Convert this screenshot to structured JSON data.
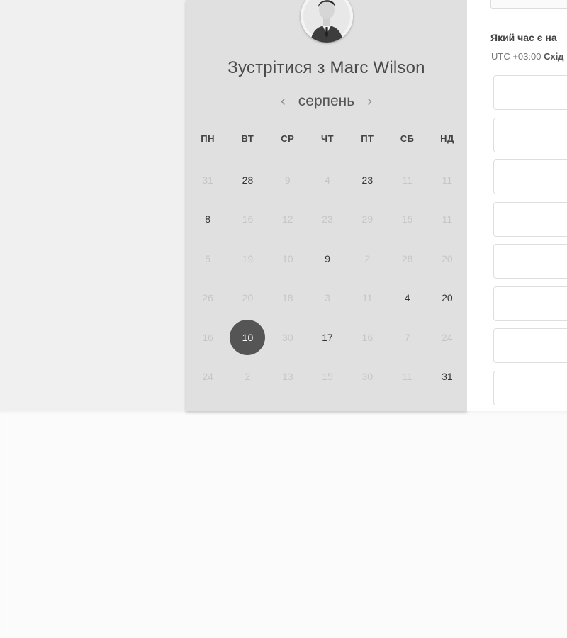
{
  "scheduler": {
    "title": "Зустрітися з Marc Wilson",
    "month": "серпень",
    "prev_icon": "‹",
    "next_icon": "›",
    "weekdays": [
      "ПН",
      "ВТ",
      "СР",
      "ЧТ",
      "ПТ",
      "СБ",
      "НД"
    ],
    "weeks": [
      [
        {
          "d": "31",
          "active": false
        },
        {
          "d": "28",
          "active": true
        },
        {
          "d": "9",
          "active": false
        },
        {
          "d": "4",
          "active": false
        },
        {
          "d": "23",
          "active": true
        },
        {
          "d": "11",
          "active": false
        },
        {
          "d": "11",
          "active": false
        }
      ],
      [
        {
          "d": "8",
          "active": true
        },
        {
          "d": "16",
          "active": false
        },
        {
          "d": "12",
          "active": false
        },
        {
          "d": "23",
          "active": false
        },
        {
          "d": "29",
          "active": false
        },
        {
          "d": "15",
          "active": false
        },
        {
          "d": "11",
          "active": false
        }
      ],
      [
        {
          "d": "5",
          "active": false
        },
        {
          "d": "19",
          "active": false
        },
        {
          "d": "10",
          "active": false
        },
        {
          "d": "9",
          "active": true
        },
        {
          "d": "2",
          "active": false
        },
        {
          "d": "28",
          "active": false
        },
        {
          "d": "20",
          "active": false
        }
      ],
      [
        {
          "d": "26",
          "active": false
        },
        {
          "d": "20",
          "active": false
        },
        {
          "d": "18",
          "active": false
        },
        {
          "d": "3",
          "active": false
        },
        {
          "d": "11",
          "active": false
        },
        {
          "d": "4",
          "active": true
        },
        {
          "d": "20",
          "active": true
        }
      ],
      [
        {
          "d": "16",
          "active": false
        },
        {
          "d": "10",
          "active": true,
          "selected": true
        },
        {
          "d": "30",
          "active": false
        },
        {
          "d": "17",
          "active": true
        },
        {
          "d": "16",
          "active": false
        },
        {
          "d": "7",
          "active": false
        },
        {
          "d": "24",
          "active": false
        }
      ],
      [
        {
          "d": "24",
          "active": false
        },
        {
          "d": "2",
          "active": false
        },
        {
          "d": "13",
          "active": false
        },
        {
          "d": "15",
          "active": false
        },
        {
          "d": "30",
          "active": false
        },
        {
          "d": "11",
          "active": false
        },
        {
          "d": "31",
          "active": true
        }
      ]
    ]
  },
  "time_panel": {
    "question": "Який час є на",
    "timezone_prefix": "UTC +03:00 ",
    "timezone_name": "Схід",
    "slot_count": 8
  },
  "colors": {
    "selected_day": "#555555",
    "calendar_bg": "#e0e0e0",
    "inactive_day": "#c6c6c6"
  }
}
